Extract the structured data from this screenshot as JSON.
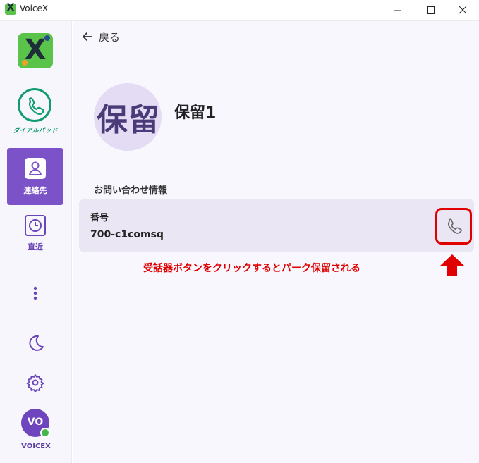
{
  "window": {
    "title": "VoiceX",
    "app_icon_letter": "X"
  },
  "sidebar": {
    "logo_letter": "X",
    "items": [
      {
        "id": "dialpad",
        "label": "ダイアルパッド",
        "icon": "phone-icon",
        "active": false
      },
      {
        "id": "contacts",
        "label": "連絡先",
        "icon": "contact-icon",
        "active": true
      },
      {
        "id": "recent",
        "label": "直近",
        "icon": "clock-icon",
        "active": false
      }
    ],
    "more_icon": "more-vertical-icon",
    "theme_icon": "moon-icon",
    "settings_icon": "gear-icon",
    "user": {
      "initials": "VO",
      "name": "VOICEX",
      "status_color": "#45b649"
    }
  },
  "main": {
    "back_label": "戻る",
    "entity": {
      "avatar_text": "保留",
      "name": "保留1"
    },
    "section_title": "お問い合わせ情報",
    "field": {
      "label": "番号",
      "value": "700-c1comsq"
    },
    "call_icon": "phone-icon",
    "annotation": "受話器ボタンをクリックするとパーク保留される"
  },
  "colors": {
    "accent": "#7b52c7",
    "dialpad_green": "#0f9c6e",
    "annotation_red": "#e00000"
  }
}
